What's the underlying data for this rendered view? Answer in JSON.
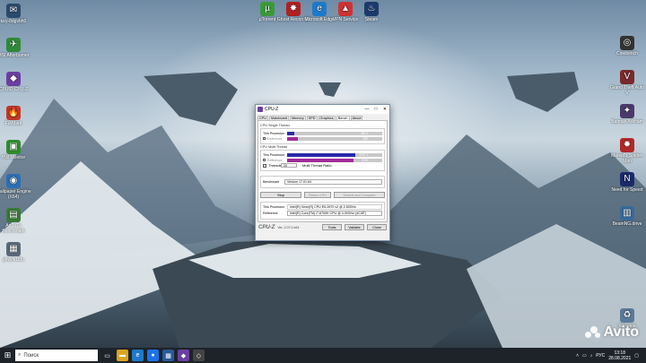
{
  "desktop": {
    "icons_left": [
      {
        "label": "key-8dgvbh0",
        "glyph": "✉",
        "color": "#2c4a6e"
      },
      {
        "label": "MSI Afterburner",
        "glyph": "✈",
        "color": "#2f8a3a"
      },
      {
        "label": "CPUID CPU-Z",
        "glyph": "◆",
        "color": "#6b3fa0"
      },
      {
        "label": "FurMark",
        "glyph": "🔥",
        "color": "#c0392b"
      },
      {
        "label": "HW Monitor",
        "glyph": "▣",
        "color": "#2d8f2d"
      },
      {
        "label": "Wallpaper Engine (Х64)",
        "glyph": "◉",
        "color": "#2d6fb5"
      },
      {
        "label": "AnTuTu Benchmark",
        "glyph": "▤",
        "color": "#3a7a3a"
      },
      {
        "label": "gkvyfk1f5u",
        "glyph": "▦",
        "color": "#5a6a7a"
      }
    ],
    "icons_top": [
      {
        "label": "µTorrent",
        "glyph": "µ",
        "color": "#3a9a3a"
      },
      {
        "label": "Ghost Recon 10",
        "glyph": "✸",
        "color": "#b02020"
      },
      {
        "label": "Microsoft Edge",
        "glyph": "e",
        "color": "#1f7ac9"
      },
      {
        "label": "VPN Service",
        "glyph": "▲",
        "color": "#cc3333"
      },
      {
        "label": "Steam",
        "glyph": "♨",
        "color": "#1b3a6b"
      }
    ],
    "icons_right": [
      {
        "label": "Cinebench",
        "glyph": "◎",
        "color": "#333"
      },
      {
        "label": "Grand Theft Auto V",
        "glyph": "V",
        "color": "#7a2a2a"
      },
      {
        "label": "Batman Arkham",
        "glyph": "✦",
        "color": "#4a3a6a"
      },
      {
        "label": "Marvel's Spider-Man",
        "glyph": "✹",
        "color": "#b02a2a"
      },
      {
        "label": "Need for Speed",
        "glyph": "N",
        "color": "#1a2a6a"
      },
      {
        "label": "BeamNG.drive",
        "glyph": "▥",
        "color": "#3a6a9a"
      }
    ],
    "recycle_bin": {
      "label": "Корзина",
      "glyph": "♻",
      "color": "#5a7a9a"
    }
  },
  "cpuz": {
    "title": "CPU-Z",
    "window_buttons": {
      "minimize": "—",
      "maximize": "□",
      "close": "✕"
    },
    "tabs": [
      "CPU",
      "Mainboard",
      "Memory",
      "SPD",
      "Graphics",
      "Bench",
      "About"
    ],
    "active_tab": "Bench",
    "single_thread": {
      "section_label": "CPU Single Thread",
      "this_label": "This Processor",
      "this_value": "380.0",
      "this_fraction": 0.08,
      "ref_label": "Reference",
      "ref_value": "550",
      "ref_fraction": 0.11
    },
    "multi_thread": {
      "section_label": "CPU Multi Thread",
      "this_label": "This Processor",
      "this_value": "3797.7",
      "this_fraction": 0.72,
      "ref_label": "Reference",
      "ref_value": "3745",
      "ref_fraction": 0.7,
      "threads_label": "Threads",
      "threads_value": "20",
      "ratio_label": "Multi Thread Ratio"
    },
    "benchmark": {
      "label": "Benchmark",
      "value": "Version 17.01.64"
    },
    "buttons": {
      "stop": "Stop",
      "stress": "Stress CPU",
      "submit": "Submit and Compare"
    },
    "processor_row": {
      "label": "This Processor",
      "value": "Intel(R) Xeon(R) CPU E5-2670 v2 @ 2.50GHz"
    },
    "reference_row": {
      "label": "Reference",
      "value": "Intel(R) Core(TM) i7-6700K CPU @ 4.00GHz (4C/8T)"
    },
    "footer": {
      "logo": "CPU-Z",
      "version": "Ver. 2.07.0.x64",
      "tools": "Tools",
      "validate": "Validate",
      "close": "Close"
    },
    "colors": {
      "this_bar": "#2a2aa8",
      "ref_bar": "#a02a9a",
      "bar_bg": "#c8c8c8"
    }
  },
  "taskbar": {
    "search_placeholder": "Поиск",
    "pinned": [
      {
        "name": "task-view",
        "glyph": "▭",
        "color": "#1e2229"
      },
      {
        "name": "explorer",
        "glyph": "▬",
        "color": "#d9a520"
      },
      {
        "name": "edge",
        "glyph": "e",
        "color": "#1f7ac9"
      },
      {
        "name": "chrome",
        "glyph": "●",
        "color": "#1a73e8"
      },
      {
        "name": "store",
        "glyph": "▦",
        "color": "#2a5a9a"
      },
      {
        "name": "cpu-z",
        "glyph": "◆",
        "color": "#6b3fa0"
      },
      {
        "name": "app",
        "glyph": "◇",
        "color": "#444"
      }
    ],
    "tray_lang": "РУС",
    "time": "13:18",
    "date": "28.08.2021"
  },
  "watermark": {
    "text": "Avito"
  }
}
